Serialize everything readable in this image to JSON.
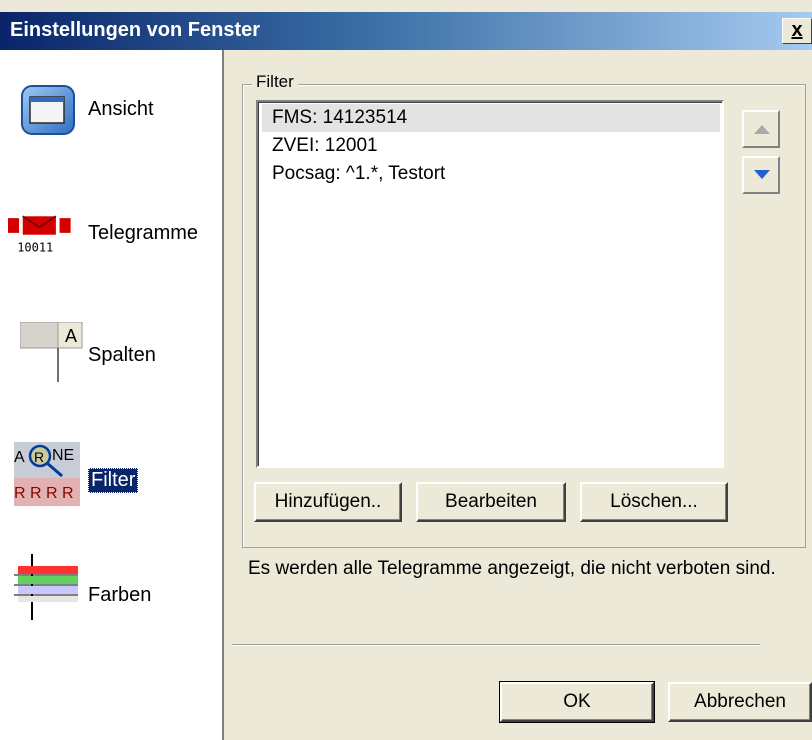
{
  "window": {
    "title": "Einstellungen von Fenster",
    "close_label": "x"
  },
  "sidebar": {
    "items": [
      {
        "label": "Ansicht",
        "icon": "window-view-icon",
        "selected": false
      },
      {
        "label": "Telegramme",
        "icon": "telegram-envelope-icon",
        "icon_text": "10011",
        "selected": false
      },
      {
        "label": "Spalten",
        "icon": "columns-header-icon",
        "icon_text": "A",
        "selected": false
      },
      {
        "label": "Filter",
        "icon": "filter-magnifier-icon",
        "icon_text": "A(R)NE RRRR",
        "selected": true
      },
      {
        "label": "Farben",
        "icon": "color-stripes-icon",
        "selected": false
      }
    ]
  },
  "filter": {
    "group_label": "Filter",
    "items": [
      {
        "text": "FMS: 14123514",
        "selected": true
      },
      {
        "text": "ZVEI: 12001",
        "selected": false
      },
      {
        "text": "Pocsag: ^1.*, Testort",
        "selected": false
      }
    ],
    "move_up_icon": "arrow-up-icon",
    "move_down_icon": "arrow-down-icon",
    "buttons": {
      "add": "Hinzufügen..",
      "edit": "Bearbeiten",
      "delete": "Löschen..."
    },
    "description": "Es werden alle Telegramme angezeigt, die nicht verboten sind."
  },
  "footer": {
    "ok_label": "OK",
    "cancel_label": "Abbrechen"
  },
  "colors": {
    "title_start": "#0a246a",
    "title_end": "#a6caf0",
    "dialog_bg": "#ece9d8",
    "selection": "#0a246a"
  }
}
